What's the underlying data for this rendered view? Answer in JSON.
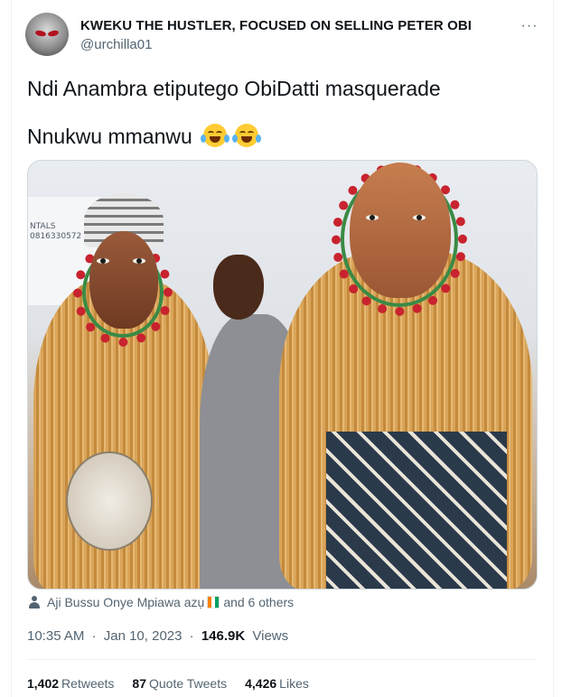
{
  "author": {
    "display_name": "KWEKU THE HUSTLER, FOCUSED ON SELLING PETER OBI",
    "handle": "@urchilla01",
    "avatar_icon": "profile-avatar"
  },
  "menu_icon": "more-icon",
  "menu_label": "···",
  "tweet": {
    "line1": "Ndi Anambra etiputego ObiDatti masquerade",
    "line2": "Nnukwu mmanwu",
    "emoji": [
      "face-with-tears-of-joy",
      "face-with-tears-of-joy"
    ]
  },
  "media": {
    "sign_text_1": "NTALS",
    "sign_text_2": "0816330572"
  },
  "tagged": {
    "icon": "person-icon",
    "name": "Aji Bussu Onye Mpiawa azụ",
    "flag": "cote-divoire-flag",
    "others": "and 6 others"
  },
  "meta": {
    "time": "10:35 AM",
    "dot": "·",
    "date": "Jan 10, 2023",
    "views_count": "146.9K",
    "views_label": "Views"
  },
  "stats": {
    "retweets_count": "1,402",
    "retweets_label": "Retweets",
    "quotes_count": "87",
    "quotes_label": "Quote Tweets",
    "likes_count": "4,426",
    "likes_label": "Likes"
  },
  "colors": {
    "text_primary": "#0f1419",
    "text_secondary": "#536471",
    "border": "#cfd9de",
    "divider": "#eff3f4"
  }
}
